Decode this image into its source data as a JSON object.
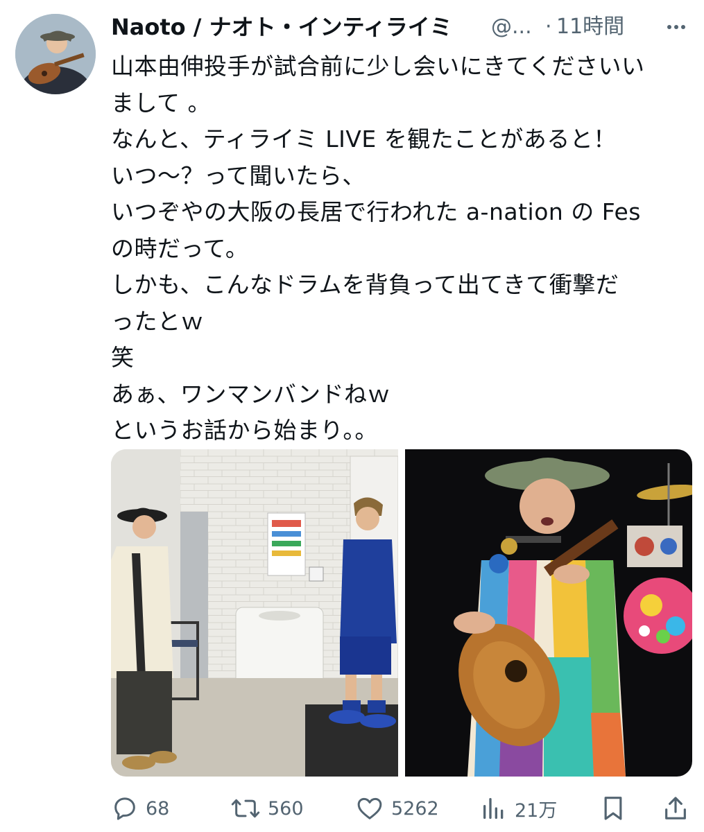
{
  "author": {
    "display_name": "Naoto / ナオト・インティライミ",
    "handle": "@...",
    "separator": "·",
    "time": "11時間",
    "avatar_icon": "guitar-player-avatar",
    "more_icon": "more-horizontal-icon"
  },
  "tweet": {
    "lines": [
      "山本由伸投手が試合前に少し会いにきてくださいい",
      "まして 。",
      "なんと、ティライミ LIVE を観たことがあると！",
      "いつ〜？って聞いたら、",
      "いつぞやの大阪の長居で行われた a-nation の Fes",
      "の時だって。",
      "しかも、こんなドラムを背負って出てきて衝撃だ",
      "ったとｗ",
      "笑",
      "あぁ、ワンマンバンドねｗ",
      "というお話から始まり。。"
    ]
  },
  "media": {
    "photos": [
      {
        "description_icon": "backstage-meeting-photo"
      },
      {
        "description_icon": "live-concert-guitar-photo"
      }
    ]
  },
  "actions": {
    "reply": {
      "icon": "reply-icon",
      "count": "68"
    },
    "retweet": {
      "icon": "retweet-icon",
      "count": "560"
    },
    "like": {
      "icon": "heart-icon",
      "count": "5262"
    },
    "views": {
      "icon": "views-chart-icon",
      "count": "21万"
    },
    "bookmark": {
      "icon": "bookmark-icon"
    },
    "share": {
      "icon": "share-icon"
    }
  },
  "colors": {
    "text": "#0f1419",
    "secondary": "#536471"
  }
}
